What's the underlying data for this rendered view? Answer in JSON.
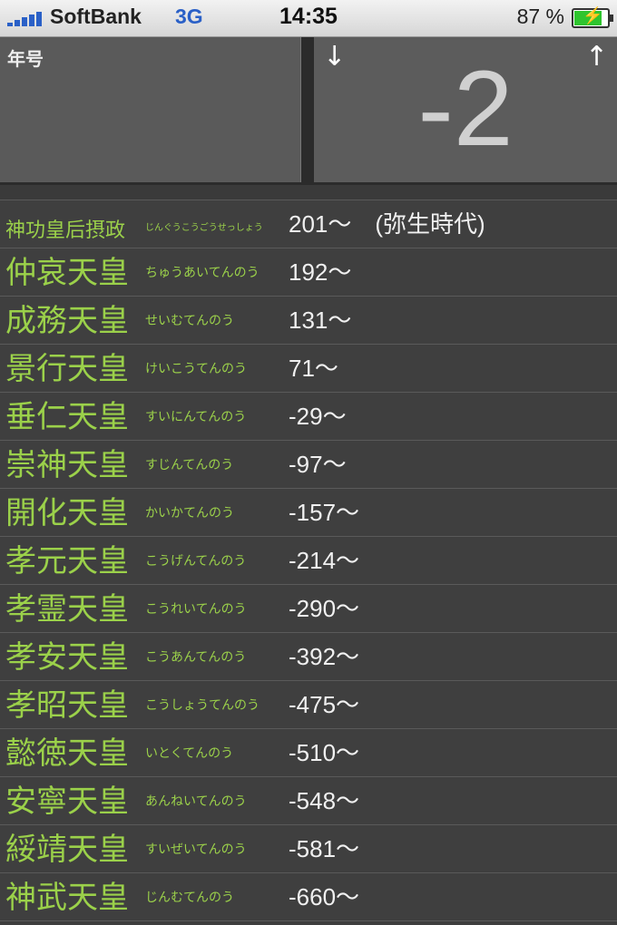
{
  "status_bar": {
    "carrier": "SoftBank",
    "network": "3G",
    "time": "14:35",
    "battery": "87 %"
  },
  "header": {
    "era_label": "年号",
    "down_arrow": "↓",
    "up_arrow": "↑",
    "value": "-2"
  },
  "rows": [
    {
      "name": "神功皇后摂政",
      "reading": "じんぐうこうごうせっしょう",
      "year": "201〜　(弥生時代)"
    },
    {
      "name": "仲哀天皇",
      "reading": "ちゅうあいてんのう",
      "year": "192〜"
    },
    {
      "name": "成務天皇",
      "reading": "せいむてんのう",
      "year": "131〜"
    },
    {
      "name": "景行天皇",
      "reading": "けいこうてんのう",
      "year": "71〜"
    },
    {
      "name": "垂仁天皇",
      "reading": "すいにんてんのう",
      "year": "-29〜"
    },
    {
      "name": "崇神天皇",
      "reading": "すじんてんのう",
      "year": "-97〜"
    },
    {
      "name": "開化天皇",
      "reading": "かいかてんのう",
      "year": "-157〜"
    },
    {
      "name": "孝元天皇",
      "reading": "こうげんてんのう",
      "year": "-214〜"
    },
    {
      "name": "孝霊天皇",
      "reading": "こうれいてんのう",
      "year": "-290〜"
    },
    {
      "name": "孝安天皇",
      "reading": "こうあんてんのう",
      "year": "-392〜"
    },
    {
      "name": "孝昭天皇",
      "reading": "こうしょうてんのう",
      "year": "-475〜"
    },
    {
      "name": "懿徳天皇",
      "reading": "いとくてんのう",
      "year": "-510〜"
    },
    {
      "name": "安寧天皇",
      "reading": "あんねいてんのう",
      "year": "-548〜"
    },
    {
      "name": "綏靖天皇",
      "reading": "すいぜいてんのう",
      "year": "-581〜"
    },
    {
      "name": "神武天皇",
      "reading": "じんむてんのう",
      "year": "-660〜"
    }
  ]
}
